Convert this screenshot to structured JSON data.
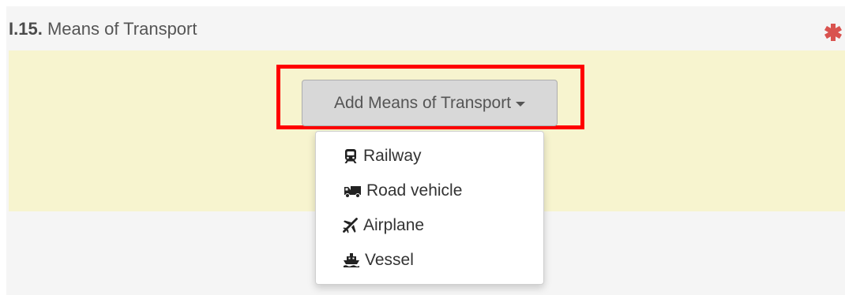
{
  "section": {
    "number": "I.15.",
    "title": "Means of Transport",
    "required_mark": "*"
  },
  "button": {
    "label": "Add Means of Transport"
  },
  "dropdown": {
    "items": [
      {
        "label": "Railway",
        "icon": "train-icon"
      },
      {
        "label": "Road vehicle",
        "icon": "truck-icon"
      },
      {
        "label": "Airplane",
        "icon": "plane-icon"
      },
      {
        "label": "Vessel",
        "icon": "ship-icon"
      }
    ]
  },
  "colors": {
    "highlight": "#ff0000",
    "required": "#d9534f",
    "panel_background": "#f7f4cf"
  }
}
